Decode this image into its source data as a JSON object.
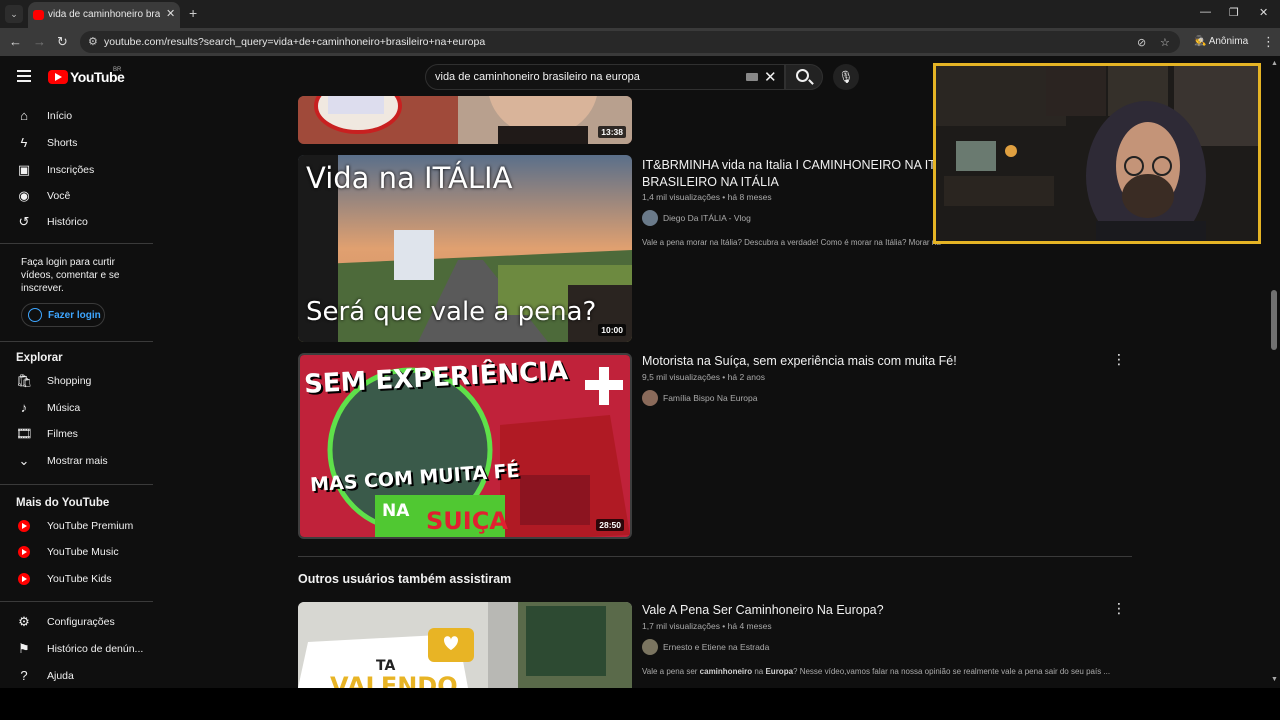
{
  "browser": {
    "tab_title": "vida de caminhoneiro brasileiro n",
    "url": "youtube.com/results?search_query=vida+de+caminhoneiro+brasileiro+na+europa",
    "profile_label": "Anônima"
  },
  "header": {
    "logo_text": "YouTube",
    "country_code": "BR",
    "search_value": "vida de caminhoneiro brasileiro na europa"
  },
  "sidebar": {
    "main_items": [
      {
        "label": "Início",
        "icon": "home-icon"
      },
      {
        "label": "Shorts",
        "icon": "shorts-icon"
      },
      {
        "label": "Inscrições",
        "icon": "subscriptions-icon"
      },
      {
        "label": "Você",
        "icon": "you-icon"
      },
      {
        "label": "Histórico",
        "icon": "history-icon"
      }
    ],
    "login_prompt": "Faça login para curtir vídeos, comentar e se inscrever.",
    "login_button": "Fazer login",
    "explore_heading": "Explorar",
    "explore_items": [
      {
        "label": "Shopping",
        "icon": "shopping-icon"
      },
      {
        "label": "Música",
        "icon": "music-icon"
      },
      {
        "label": "Filmes",
        "icon": "movies-icon"
      },
      {
        "label": "Mostrar mais",
        "icon": "chevron-down-icon"
      }
    ],
    "more_heading": "Mais do YouTube",
    "more_items": [
      {
        "label": "YouTube Premium"
      },
      {
        "label": "YouTube Music"
      },
      {
        "label": "YouTube Kids"
      }
    ],
    "settings_items": [
      {
        "label": "Configurações",
        "icon": "gear-icon"
      },
      {
        "label": "Histórico de denún...",
        "icon": "flag-icon"
      },
      {
        "label": "Ajuda",
        "icon": "help-icon"
      }
    ]
  },
  "results": [
    {
      "duration": "13:38"
    },
    {
      "title_line1": "IT&BRMINHA vida na Italia I CAMINHONEIRO NA ITÁLIA",
      "title_line2": "BRASILEIRO NA ITÁLIA",
      "meta": "1,4 mil visualizações • há 8 meses",
      "channel": "Diego Da ITÁLIA - Vlog",
      "description": "Vale a pena morar na Itália? Descubra a verdade! Como é morar na Itália? Morar na",
      "duration": "10:00",
      "thumb_text_top": "Vida na ITÁLIA",
      "thumb_text_bottom": "Será que vale a pena?"
    },
    {
      "title": "Motorista na Suíça, sem experiência mais com muita Fé!",
      "meta": "9,5 mil visualizações • há 2 anos",
      "channel": "Família Bispo Na Europa",
      "duration": "28:50",
      "thumb_text_top": "SEM EXPERIÊNCIA",
      "thumb_text_mid": "MAS COM MUITA FÉ",
      "thumb_text_na": "NA",
      "thumb_text_country": "SUIÇA"
    }
  ],
  "section_heading": "Outros usuários também assistiram",
  "related": [
    {
      "title": "Vale A Pena Ser Caminhoneiro Na Europa?",
      "meta": "1,7 mil visualizações • há 4 meses",
      "channel": "Ernesto e Etiene na Estrada",
      "desc_1": "Vale a pena ser ",
      "desc_b1": "caminhoneiro",
      "desc_2": " na ",
      "desc_b2": "Europa",
      "desc_3": "? Nesse vídeo,vamos falar na nossa opinião se realmente vale a pena sair do seu país ...",
      "thumb_text_1": "TA",
      "thumb_text_2": "VALENDO"
    }
  ],
  "colors": {
    "brand_red": "#ff0000",
    "link_blue": "#3ea6ff",
    "webcam_border": "#e5b425"
  }
}
